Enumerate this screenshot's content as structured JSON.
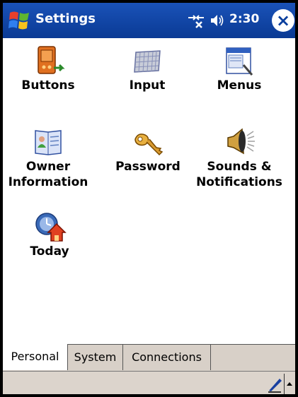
{
  "titlebar": {
    "app_title": "Settings",
    "time": "2:30",
    "close_label": "×",
    "start_icon": "windows-flag-icon",
    "connectivity_icon": "connectivity-icon",
    "volume_icon": "speaker-icon"
  },
  "items": [
    {
      "label_line1": "Buttons",
      "label_line2": "",
      "icon": "buttons-icon"
    },
    {
      "label_line1": "Input",
      "label_line2": "",
      "icon": "keyboard-icon"
    },
    {
      "label_line1": "Menus",
      "label_line2": "",
      "icon": "menus-icon"
    },
    {
      "label_line1": "Owner",
      "label_line2": "Information",
      "icon": "owner-card-icon"
    },
    {
      "label_line1": "Password",
      "label_line2": "",
      "icon": "keys-icon"
    },
    {
      "label_line1": "Sounds &",
      "label_line2": "Notifications",
      "icon": "speaker-sound-icon"
    },
    {
      "label_line1": "Today",
      "label_line2": "",
      "icon": "today-house-icon"
    }
  ],
  "tabs": [
    {
      "label": "Personal",
      "active": true
    },
    {
      "label": "System",
      "active": false
    },
    {
      "label": "Connections",
      "active": false
    }
  ],
  "colors": {
    "titlebar": "#0a3f9e",
    "tabbar": "#d8d0c8"
  }
}
